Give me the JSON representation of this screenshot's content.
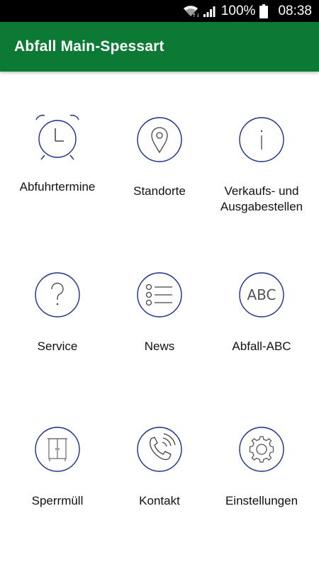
{
  "status_bar": {
    "battery": "100%",
    "time": "08:38"
  },
  "app_bar": {
    "title": "Abfall Main-Spessart",
    "color": "#0b7a35"
  },
  "icon_color": "#1a2f8a",
  "menu": {
    "items": [
      {
        "label": "Abfuhrtermine",
        "icon": "alarm-clock-icon"
      },
      {
        "label": "Standorte",
        "icon": "location-pin-icon"
      },
      {
        "label": "Verkaufs- und\nAusgabestellen",
        "icon": "info-icon"
      },
      {
        "label": "Service",
        "icon": "question-icon"
      },
      {
        "label": "News",
        "icon": "list-icon"
      },
      {
        "label": "Abfall-ABC",
        "icon": "abc-icon"
      },
      {
        "label": "Sperrmüll",
        "icon": "wardrobe-icon"
      },
      {
        "label": "Kontakt",
        "icon": "phone-icon"
      },
      {
        "label": "Einstellungen",
        "icon": "gear-icon"
      }
    ]
  }
}
